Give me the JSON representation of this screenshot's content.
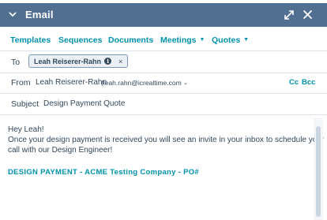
{
  "header": {
    "title": "Email",
    "color": "#516f90",
    "icons": [
      "chevron-down-icon",
      "expand-icon",
      "close-icon"
    ]
  },
  "tabs": [
    {
      "label": "Templates",
      "dropdown": false
    },
    {
      "label": "Sequences",
      "dropdown": false
    },
    {
      "label": "Documents",
      "dropdown": false
    },
    {
      "label": "Meetings",
      "dropdown": true
    },
    {
      "label": "Quotes",
      "dropdown": true
    }
  ],
  "to": {
    "label": "To",
    "recipient": "Leah Reiserer-Rahn",
    "remove_glyph": "×"
  },
  "from": {
    "label": "From",
    "name": "Leah Reiserer-Rahn",
    "email": "(leah.rahn@icrealtime.com",
    "cc": "Cc",
    "bcc": "Bcc"
  },
  "subject": {
    "label": "Subject",
    "value": "Design Payment Quote"
  },
  "body": {
    "lines": [
      "Hey Leah!",
      "Once your design payment is received you will see an invite in your inbox to schedule your",
      "call with our Design Engineer!"
    ],
    "link": "DESIGN PAYMENT - ACME Testing Company - PO#"
  },
  "colors": {
    "accent": "#0091ae",
    "text": "#33475b",
    "header": "#516f90"
  }
}
